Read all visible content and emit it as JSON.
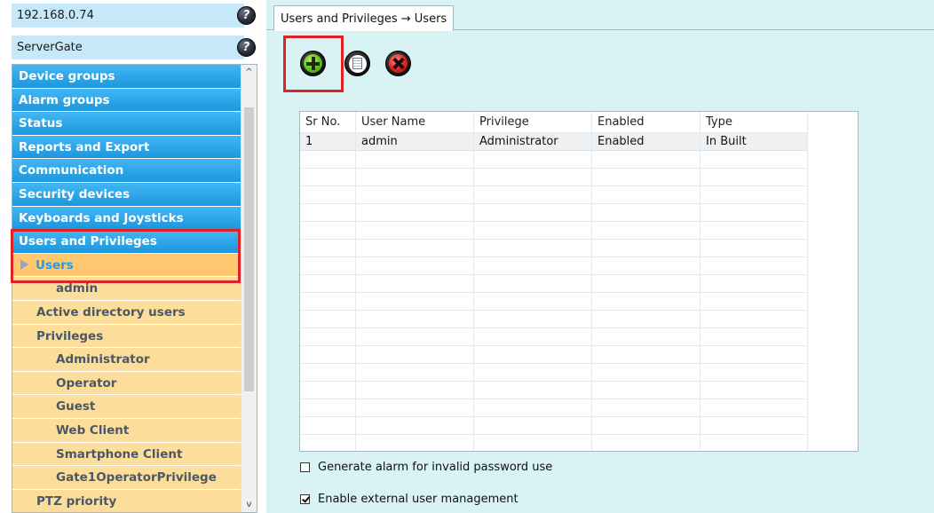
{
  "servers": [
    {
      "label": "192.168.0.74",
      "help_icon": "help-icon"
    },
    {
      "label": "ServerGate",
      "help_icon": "help-icon"
    }
  ],
  "tree": {
    "items": [
      {
        "label": "Device groups",
        "style": "blue"
      },
      {
        "label": "Alarm groups",
        "style": "blue"
      },
      {
        "label": "Status",
        "style": "blue"
      },
      {
        "label": "Reports and Export",
        "style": "blue"
      },
      {
        "label": "Communication",
        "style": "blue"
      },
      {
        "label": "Security devices",
        "style": "blue"
      },
      {
        "label": "Keyboards and Joysticks",
        "style": "blue"
      },
      {
        "label": "Users and Privileges",
        "style": "blue"
      },
      {
        "label": "Users",
        "style": "selected"
      },
      {
        "label": "admin",
        "style": "l2"
      },
      {
        "label": "Active directory users",
        "style": "l1"
      },
      {
        "label": "Privileges",
        "style": "l1"
      },
      {
        "label": "Administrator",
        "style": "l2"
      },
      {
        "label": "Operator",
        "style": "l2"
      },
      {
        "label": "Guest",
        "style": "l2"
      },
      {
        "label": "Web Client",
        "style": "l2"
      },
      {
        "label": "Smartphone Client",
        "style": "l2"
      },
      {
        "label": "Gate1OperatorPrivilege",
        "style": "l2"
      },
      {
        "label": "PTZ priority",
        "style": "l1"
      }
    ],
    "scroll_up": "^",
    "scroll_down": "v"
  },
  "tab": {
    "label": "Users and Privileges → Users"
  },
  "toolbar": {
    "add_icon": "add-icon",
    "edit_icon": "edit-icon",
    "delete_icon": "delete-icon"
  },
  "grid": {
    "columns": [
      "Sr No.",
      "User Name",
      "Privilege",
      "Enabled",
      "Type"
    ],
    "rows": [
      [
        "1",
        "admin",
        "Administrator",
        "Enabled",
        "In Built"
      ]
    ]
  },
  "options": [
    {
      "label": "Generate alarm for invalid password use",
      "checked": false
    },
    {
      "label": "Enable external user management",
      "checked": true
    }
  ],
  "colors": {
    "accent_highlight": "#e02227",
    "tree_blue": "#2aa6ea",
    "tree_orange": "#fcdd9a",
    "panel_bg": "#d9f2f4"
  }
}
